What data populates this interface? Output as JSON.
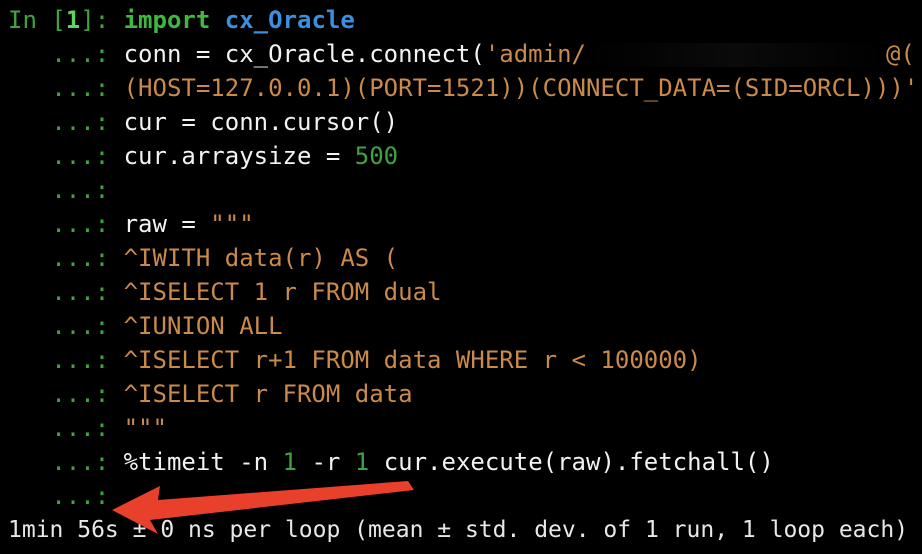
{
  "prompt": {
    "in_label": "In [",
    "cell_number": "1",
    "close": "]: ",
    "continuation": "   ...: "
  },
  "lines": {
    "l1": {
      "kw": "import",
      "module": "cx_Oracle"
    },
    "l2": {
      "pre": "conn = cx_Oracle.connect(",
      "str_start": "'admin/",
      "str_end": "@("
    },
    "l3": {
      "str": "(HOST=127.0.0.1)(PORT=1521))(CONNECT_DATA=(SID=ORCL)))'",
      "post": ")"
    },
    "l4": {
      "code": "cur = conn.cursor()"
    },
    "l5": {
      "code": "cur.arraysize = ",
      "num": "500"
    },
    "l7": {
      "code": "raw = ",
      "str": "\"\"\""
    },
    "l8": {
      "str": "^IWITH data(r) AS ("
    },
    "l9": {
      "str": "^ISELECT 1 r FROM dual"
    },
    "l10": {
      "str": "^IUNION ALL"
    },
    "l11": {
      "str": "^ISELECT r+1 FROM data WHERE r < 100000)"
    },
    "l12": {
      "str": "^ISELECT r FROM data"
    },
    "l13": {
      "str": "\"\"\""
    },
    "l14": {
      "magic": "%timeit -n ",
      "n": "1",
      "r_flag": " -r ",
      "r": "1",
      "call": " cur.execute(raw).fetchall()"
    }
  },
  "output": "1min 56s ± 0 ns per loop (mean ± std. dev. of 1 run, 1 loop each)",
  "colors": {
    "background": "#000000",
    "prompt": "#3fa33f",
    "string": "#c98a4a",
    "keyword": "#3fb83f",
    "module": "#3a8fe0",
    "arrow": "#e8402a"
  },
  "icons": {
    "annotation": "red-arrow-icon"
  }
}
